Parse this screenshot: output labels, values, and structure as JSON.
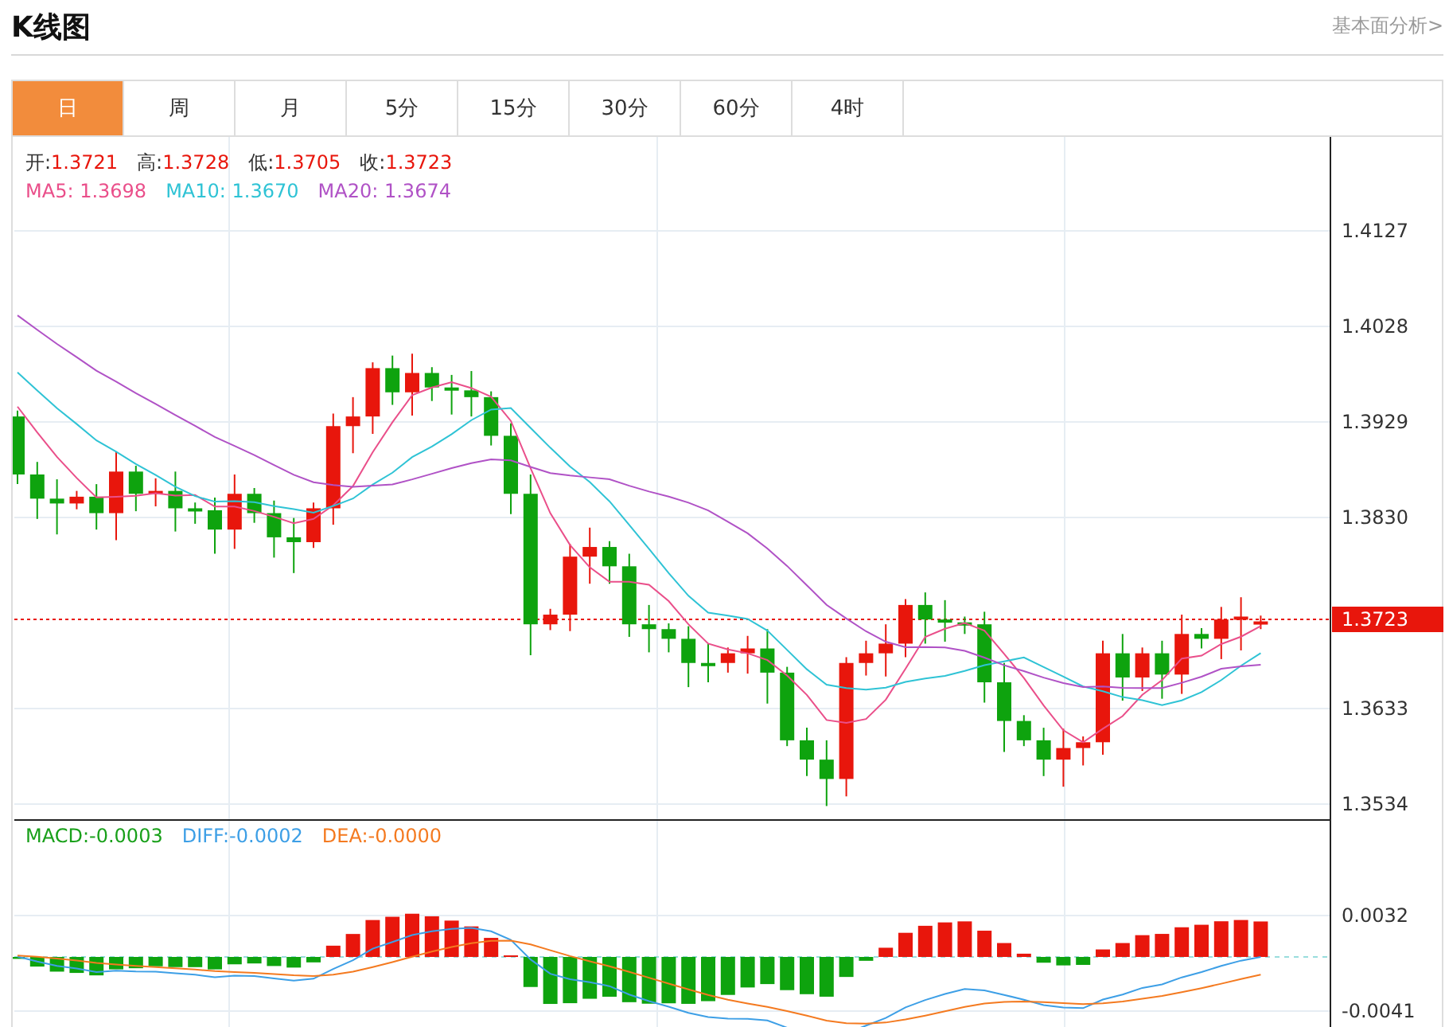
{
  "header": {
    "title": "K线图",
    "link": "基本面分析>"
  },
  "tabs": [
    {
      "label": "日",
      "selected": true
    },
    {
      "label": "周",
      "selected": false
    },
    {
      "label": "月",
      "selected": false
    },
    {
      "label": "5分",
      "selected": false
    },
    {
      "label": "15分",
      "selected": false
    },
    {
      "label": "30分",
      "selected": false
    },
    {
      "label": "60分",
      "selected": false
    },
    {
      "label": "4时",
      "selected": false
    }
  ],
  "quote": [
    {
      "label": "开:",
      "value": "1.3721"
    },
    {
      "label": "高:",
      "value": "1.3728"
    },
    {
      "label": "低:",
      "value": "1.3705"
    },
    {
      "label": "收:",
      "value": "1.3723"
    }
  ],
  "moving_averages": [
    {
      "label": "MA5:",
      "value": "1.3698",
      "color": "#ea4f8a"
    },
    {
      "label": "MA10:",
      "value": "1.3670",
      "color": "#2fc3d5"
    },
    {
      "label": "MA20:",
      "value": "1.3674",
      "color": "#b052c6"
    }
  ],
  "price_axis": [
    "1.4127",
    "1.4028",
    "1.3929",
    "1.3830",
    "1.3633",
    "1.3534"
  ],
  "current_price": "1.3723",
  "macd_legend": [
    {
      "label": "MACD:",
      "value": "-0.0003",
      "color": "#19a01a"
    },
    {
      "label": "DIFF:",
      "value": "-0.0002",
      "color": "#3d9fe6"
    },
    {
      "label": "DEA:",
      "value": "-0.0000",
      "color": "#f47a20"
    }
  ],
  "macd_axis": [
    "0.0032",
    "-0.0041"
  ]
}
